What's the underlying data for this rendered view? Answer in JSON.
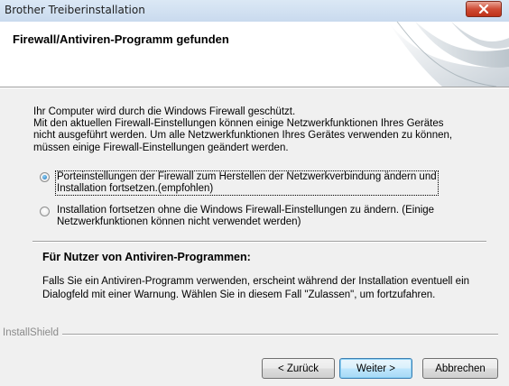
{
  "window": {
    "title": "Brother Treiberinstallation"
  },
  "header": {
    "title": "Firewall/Antiviren-Programm gefunden"
  },
  "body": {
    "intro_lines": [
      "Ihr Computer wird durch die Windows Firewall geschützt.",
      "Mit den aktuellen Firewall-Einstellungen können einige Netzwerkfunktionen Ihres Gerätes",
      "nicht ausgeführt werden. Um alle Netzwerkfunktionen Ihres Gerätes verwenden zu können,",
      "müssen einige Firewall-Einstellungen geändert werden."
    ],
    "options": [
      {
        "lines": [
          "Porteinstellungen der Firewall zum Herstellen der Netzwerkverbindung ändern und",
          "Installation fortsetzen.(empfohlen)"
        ],
        "selected": true
      },
      {
        "lines": [
          "Installation fortsetzen ohne die Windows Firewall-Einstellungen zu ändern. (Einige",
          "Netzwerkfunktionen können nicht verwendet werden)"
        ],
        "selected": false
      }
    ],
    "antivirus_heading": "Für Nutzer von Antiviren-Programmen:",
    "antivirus_lines": [
      "Falls Sie ein Antiviren-Programm verwenden, erscheint während der Installation eventuell ein",
      "Dialogfeld mit einer Warnung. Wählen Sie in diesem Fall \"Zulassen\", um fortzufahren."
    ]
  },
  "footer": {
    "brand": "InstallShield",
    "back_label": "< Zurück",
    "next_label": "Weiter >",
    "cancel_label": "Abbrechen"
  },
  "colors": {
    "close_button": "#cf4c36",
    "header_background": "#ffffff",
    "dialog_background": "#f0f0f0"
  },
  "icons": {
    "close": "close-icon",
    "header_graphic": "header-swoosh-graphic"
  }
}
